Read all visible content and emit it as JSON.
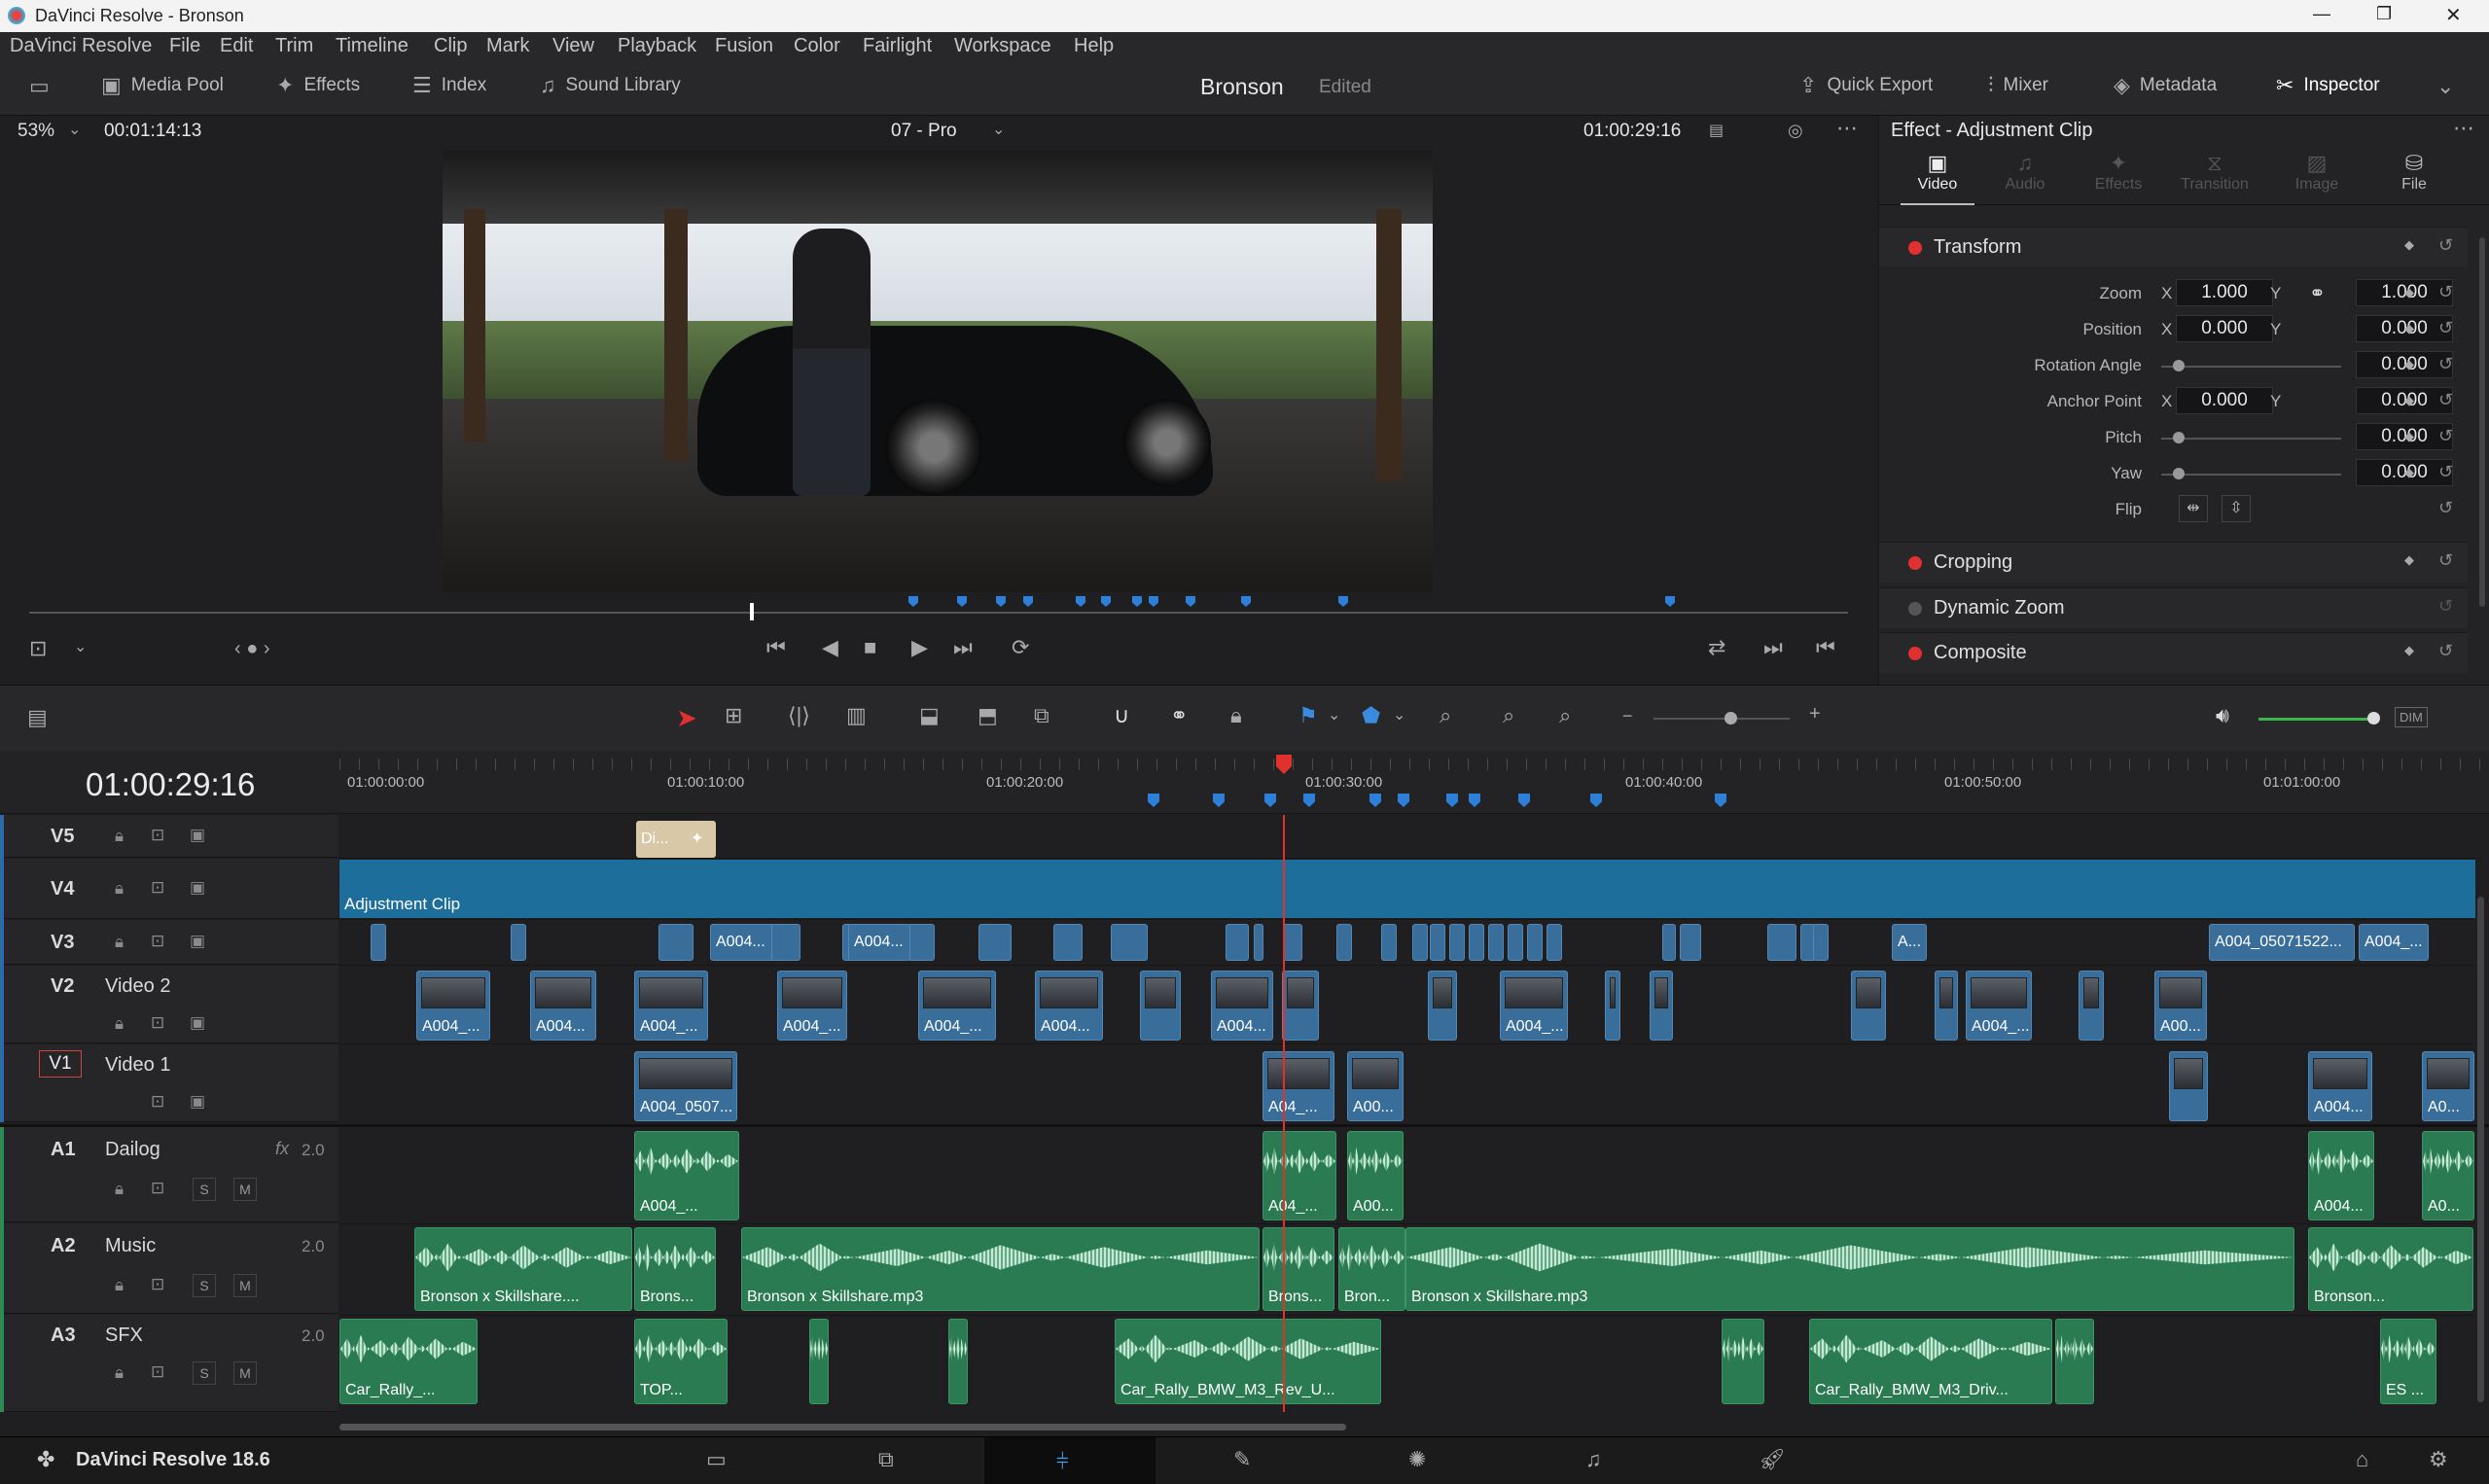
{
  "window": {
    "title": "DaVinci Resolve - Bronson",
    "controls": [
      "—",
      "❐",
      "✕"
    ]
  },
  "menu": [
    "DaVinci Resolve",
    "File",
    "Edit",
    "Trim",
    "Timeline",
    "Clip",
    "Mark",
    "View",
    "Playback",
    "Fusion",
    "Color",
    "Fairlight",
    "Workspace",
    "Help"
  ],
  "toolbar": {
    "media_pool": "Media Pool",
    "effects": "Effects",
    "index": "Index",
    "sound_library": "Sound Library",
    "project": "Bronson",
    "project_status": "Edited",
    "quick_export": "Quick Export",
    "mixer": "Mixer",
    "metadata": "Metadata",
    "inspector": "Inspector"
  },
  "viewer": {
    "zoom": "53%",
    "source_tc": "00:01:14:13",
    "timeline_name": "07 - Pro",
    "record_tc": "01:00:29:16"
  },
  "inspector": {
    "title": "Effect - Adjustment Clip",
    "tabs": [
      "Video",
      "Audio",
      "Effects",
      "Transition",
      "Image",
      "File"
    ],
    "transform": {
      "title": "Transform",
      "zoom_label": "Zoom",
      "zoom_x": "1.000",
      "zoom_y": "1.000",
      "position_label": "Position",
      "position_x": "0.000",
      "position_y": "0.000",
      "rotation_label": "Rotation Angle",
      "rotation": "0.000",
      "anchor_label": "Anchor Point",
      "anchor_x": "0.000",
      "anchor_y": "0.000",
      "pitch_label": "Pitch",
      "pitch": "0.000",
      "yaw_label": "Yaw",
      "yaw": "0.000",
      "flip_label": "Flip",
      "x": "X",
      "y": "Y"
    },
    "sections": [
      "Cropping",
      "Dynamic Zoom",
      "Composite"
    ]
  },
  "timeline": {
    "timecode": "01:00:29:16",
    "ruler": [
      "01:00:00:00",
      "01:00:10:00",
      "01:00:20:00",
      "01:00:30:00",
      "01:00:40:00",
      "01:00:50:00",
      "01:01:00:00"
    ],
    "tracks": {
      "v5": "V5",
      "v4": "V4",
      "v3": "V3",
      "v2": "V2",
      "v2_name": "Video 2",
      "v1": "V1",
      "v1_name": "Video 1",
      "a1": "A1",
      "a1_name": "Dailog",
      "a1_ch": "2.0",
      "a1_fx": "fx",
      "a2": "A2",
      "a2_name": "Music",
      "a2_ch": "2.0",
      "a3": "A3",
      "a3_name": "SFX",
      "a3_ch": "2.0",
      "solo": "S",
      "mute": "M"
    },
    "v5_clip": "Di...",
    "v4_clip": "Adjustment Clip",
    "v3_labels": [
      "A004...",
      "A004...",
      "A...",
      "A004_05071522...",
      "A004_..."
    ],
    "v2_labels": [
      "A004_...",
      "A004...",
      "A004_...",
      "A004_...",
      "A004_...",
      "A004...",
      "A004...",
      "A004...",
      "A004_...",
      "A00..."
    ],
    "v1_labels": [
      "A004_0507...",
      "A04_...",
      "A00...",
      "A004...",
      "A0..."
    ],
    "a1_labels": [
      "A004_...",
      "A04_...",
      "A00...",
      "A004...",
      "A0..."
    ],
    "a2_labels": [
      "Bronson x Skillshare....",
      "Brons...",
      "Bronson x Skillshare.mp3",
      "Brons...",
      "Bron...",
      "Bronson x Skillshare.mp3",
      "Bronson..."
    ],
    "a3_labels": [
      "Car_Rally_...",
      "TOP...",
      "Car_Rally_BMW_M3_Rev_U...",
      "Car_Rally_BMW_M3_Driv...",
      "ES ..."
    ]
  },
  "footer": {
    "app": "DaVinci Resolve 18.6"
  },
  "colors": {
    "accent_red": "#e03030",
    "video_clip": "#3a6e9a",
    "audio_clip": "#2a7a52",
    "adjustment": "#1e6e9c",
    "marker": "#2d7fd8"
  }
}
